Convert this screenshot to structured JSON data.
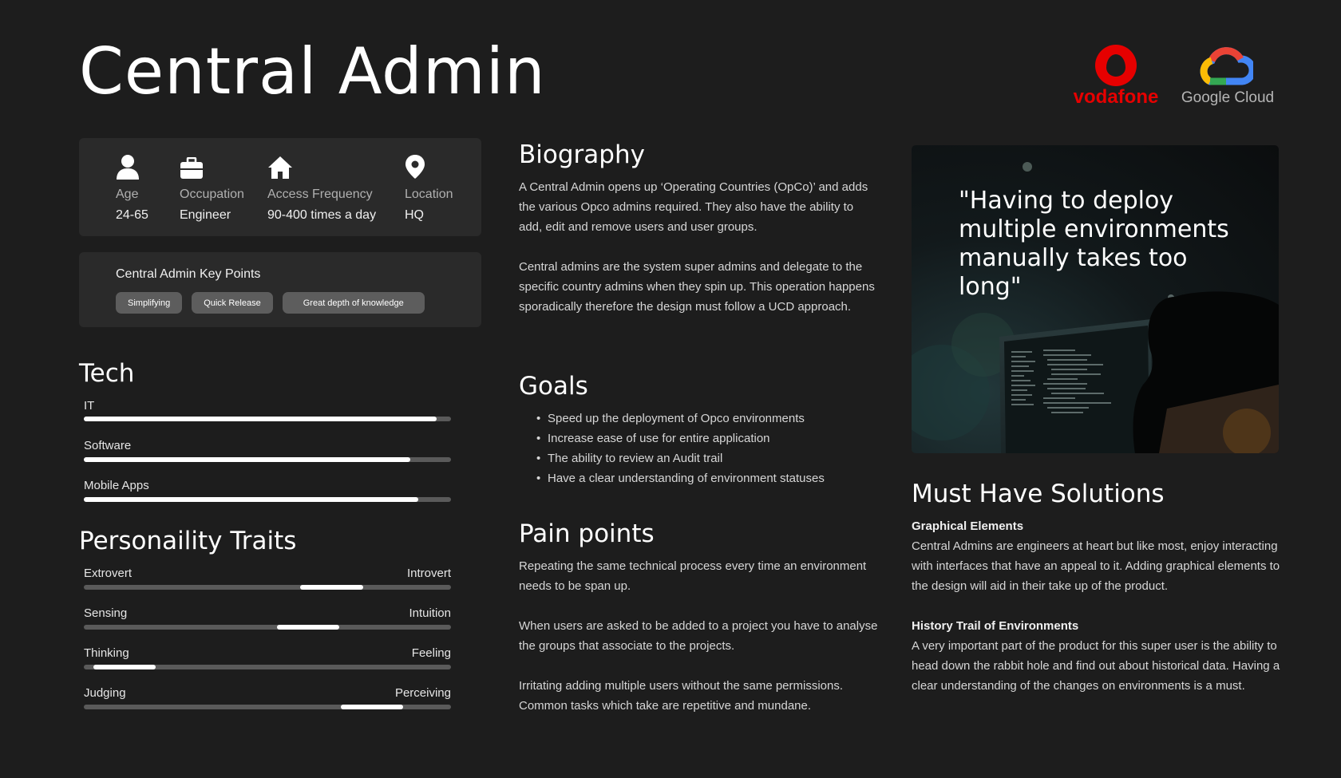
{
  "title": "Central Admin",
  "logos": {
    "vodafone": "vodafone",
    "google_cloud": "Google Cloud"
  },
  "stats": [
    {
      "icon": "person-icon",
      "label": "Age",
      "value": "24-65"
    },
    {
      "icon": "briefcase-icon",
      "label": "Occupation",
      "value": "Engineer"
    },
    {
      "icon": "home-icon",
      "label": "Access Frequency",
      "value": "90-400 times a day"
    },
    {
      "icon": "location-pin-icon",
      "label": "Location",
      "value": "HQ"
    }
  ],
  "key_points": {
    "title": "Central Admin Key Points",
    "chips": [
      "Simplifying",
      "Quick Release",
      "Great depth of knowledge"
    ]
  },
  "tech": {
    "heading": "Tech",
    "items": [
      {
        "label": "IT",
        "level": 0.96
      },
      {
        "label": "Software",
        "level": 0.89
      },
      {
        "label": "Mobile Apps",
        "level": 0.91
      }
    ]
  },
  "personality": {
    "heading": "Personaility Traits",
    "items": [
      {
        "left": "Extrovert",
        "right": "Introvert",
        "start": 0.59,
        "end": 0.76
      },
      {
        "left": "Sensing",
        "right": "Intuition",
        "start": 0.525,
        "end": 0.695
      },
      {
        "left": "Thinking",
        "right": "Feeling",
        "start": 0.025,
        "end": 0.195
      },
      {
        "left": "Judging",
        "right": "Perceiving",
        "start": 0.7,
        "end": 0.87
      }
    ]
  },
  "biography": {
    "heading": "Biography",
    "paragraphs": [
      "A Central Admin opens up ‘Operating Countries (OpCo)’ and adds the various Opco admins required. They also have the ability to add, edit and remove users and user groups.",
      "Central admins are the system super admins and delegate to the specific country admins when they spin up. This operation happens sporadically therefore the design must follow a UCD approach."
    ]
  },
  "goals": {
    "heading": "Goals",
    "items": [
      "Speed up the deployment of Opco environments",
      "Increase ease of use for entire application",
      "The ability to review an Audit trail",
      "Have a clear understanding of environment statuses"
    ]
  },
  "pain_points": {
    "heading": "Pain points",
    "paragraphs": [
      "Repeating the same technical process every time an environment needs to be span up.",
      "When users are asked to be added to a project you have to analyse the groups that associate to the projects.",
      "Irritating adding multiple users without the same permissions. Common tasks which take are repetitive and mundane."
    ]
  },
  "quote": "\"Having to deploy multiple environments manually takes too long\"",
  "solutions": {
    "heading": "Must Have Solutions",
    "items": [
      {
        "title": "Graphical Elements",
        "text": "Central Admins are engineers at heart but like most, enjoy interacting with interfaces that have an appeal to it. Adding graphical elements to the design will aid in their take up of the product."
      },
      {
        "title": "History Trail of Environments",
        "text": "A very important part of the product for this super user is the ability to head down the rabbit hole and find out about historical data. Having a clear understanding of the changes on environments is a must."
      }
    ]
  }
}
